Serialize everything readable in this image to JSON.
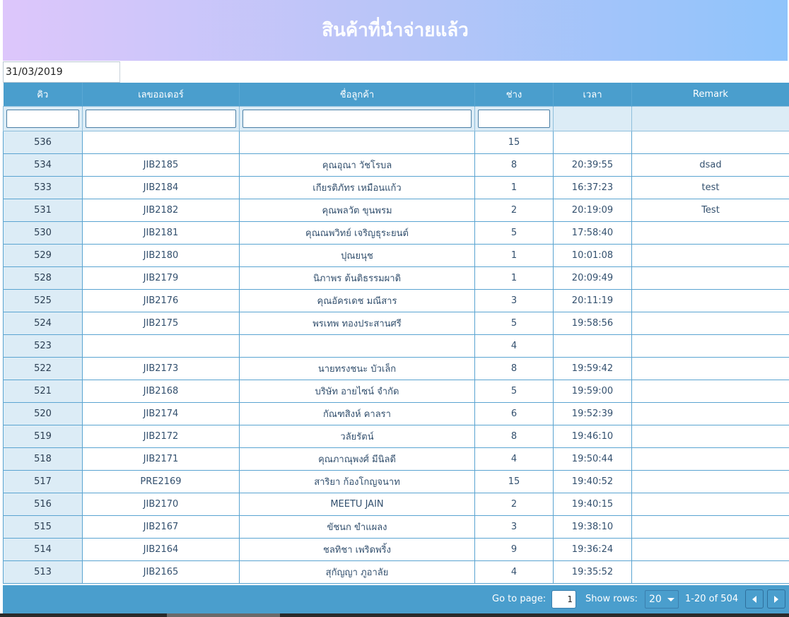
{
  "header": {
    "title": "สินค้าที่นำจ่ายแล้ว"
  },
  "date_filter": {
    "value": "31/03/2019"
  },
  "table": {
    "columns": [
      "คิว",
      "เลขออเดอร์",
      "ชื่อลูกค้า",
      "ช่าง",
      "เวลา",
      "Remark"
    ],
    "rows": [
      [
        "536",
        "",
        "",
        "15",
        "",
        ""
      ],
      [
        "534",
        "JIB2185",
        "คุณอุณา วัชโรบล",
        "8",
        "20:39:55",
        "dsad"
      ],
      [
        "533",
        "JIB2184",
        "เกียรติภัทร เหมือนแก้ว",
        "1",
        "16:37:23",
        "test"
      ],
      [
        "531",
        "JIB2182",
        "คุณพลวัต ขุนพรม",
        "2",
        "20:19:09",
        "Test"
      ],
      [
        "530",
        "JIB2181",
        "คุณณพวิทย์ เจริญธุระยนต์",
        "5",
        "17:58:40",
        ""
      ],
      [
        "529",
        "JIB2180",
        "ปุณยนุช",
        "1",
        "10:01:08",
        ""
      ],
      [
        "528",
        "JIB2179",
        "นิภาพร ต้นติธรรมผาดิ",
        "1",
        "20:09:49",
        ""
      ],
      [
        "525",
        "JIB2176",
        "คุณอัครเดช มณีสาร",
        "3",
        "20:11:19",
        ""
      ],
      [
        "524",
        "JIB2175",
        "พรเทพ ทองประสานศรี",
        "5",
        "19:58:56",
        ""
      ],
      [
        "523",
        "",
        "",
        "4",
        "",
        ""
      ],
      [
        "522",
        "JIB2173",
        "นายทรงชนะ บัวเล็ก",
        "8",
        "19:59:42",
        ""
      ],
      [
        "521",
        "JIB2168",
        "บริษัท อายไซน์ จำกัด",
        "5",
        "19:59:00",
        ""
      ],
      [
        "520",
        "JIB2174",
        "กัณฑสิงห์ คาลรา",
        "6",
        "19:52:39",
        ""
      ],
      [
        "519",
        "JIB2172",
        "วลัยรัตน์",
        "8",
        "19:46:10",
        ""
      ],
      [
        "518",
        "JIB2171",
        "คุณภาณุพงศ์ มีนิลดี",
        "4",
        "19:50:44",
        ""
      ],
      [
        "517",
        "PRE2169",
        "สาริยา ก้องโกญจนาท",
        "15",
        "19:40:52",
        ""
      ],
      [
        "516",
        "JIB2170",
        "MEETU JAIN",
        "2",
        "19:40:15",
        ""
      ],
      [
        "515",
        "JIB2167",
        "ขัชนก ขำแผลง",
        "3",
        "19:38:10",
        ""
      ],
      [
        "514",
        "JIB2164",
        "ชลทิชา เพริดพริ้ง",
        "9",
        "19:36:24",
        ""
      ],
      [
        "513",
        "JIB2165",
        "สุกัญญา ภูอาลัย",
        "4",
        "19:35:52",
        ""
      ]
    ]
  },
  "pagination": {
    "goto_label": "Go to page:",
    "page_value": "1",
    "show_rows_label": "Show rows:",
    "rows_value": "20",
    "range_text": "1-20 of 504"
  },
  "icons": {
    "prev": "chevron-left-icon",
    "next": "chevron-right-icon",
    "dropdown": "caret-down-icon"
  },
  "colors": {
    "header_gradient_start": "#ddc6fb",
    "header_gradient_end": "#8fc4fb",
    "table_header": "#4a9ecd",
    "queue_cell": "#dcecf6"
  }
}
